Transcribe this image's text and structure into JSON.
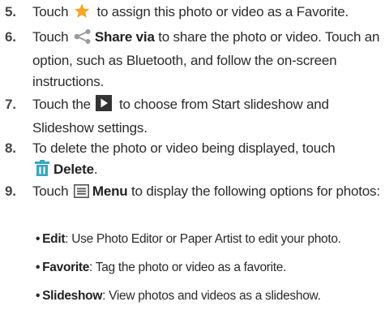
{
  "steps": [
    {
      "num": "5.",
      "before": "Touch",
      "icon": "star-icon",
      "text": "to assign this photo or video as a Favorite."
    },
    {
      "num": "6.",
      "before": "Touch",
      "icon": "share-icon",
      "bold": "Share via",
      "text": "to share the photo or video. Touch an option, such as Bluetooth, and follow the on-screen instructions."
    },
    {
      "num": "7.",
      "before": "Touch the",
      "icon": "play-icon",
      "text": "to choose from Start slideshow and Slideshow settings."
    },
    {
      "num": "8.",
      "text": "To delete the photo or video being displayed, touch",
      "icon": "trash-icon",
      "bold": "Delete",
      "after": "."
    },
    {
      "num": "9.",
      "before": "Touch",
      "icon": "menu-icon",
      "bold": "Menu",
      "text": "to display the following options for photos:"
    }
  ],
  "bullets": [
    {
      "term": "Edit",
      "text": ": Use Photo Editor or Paper Artist to edit your photo."
    },
    {
      "term": "Favorite",
      "text": ": Tag the photo or video as a favorite."
    },
    {
      "term": "Slideshow",
      "text": ": View photos and videos as a slideshow."
    }
  ],
  "colors": {
    "star": "#f5a623",
    "share": "#9a9a9a",
    "play_bg": "#333333",
    "trash": "#3aa6b9",
    "menu": "#555555"
  }
}
